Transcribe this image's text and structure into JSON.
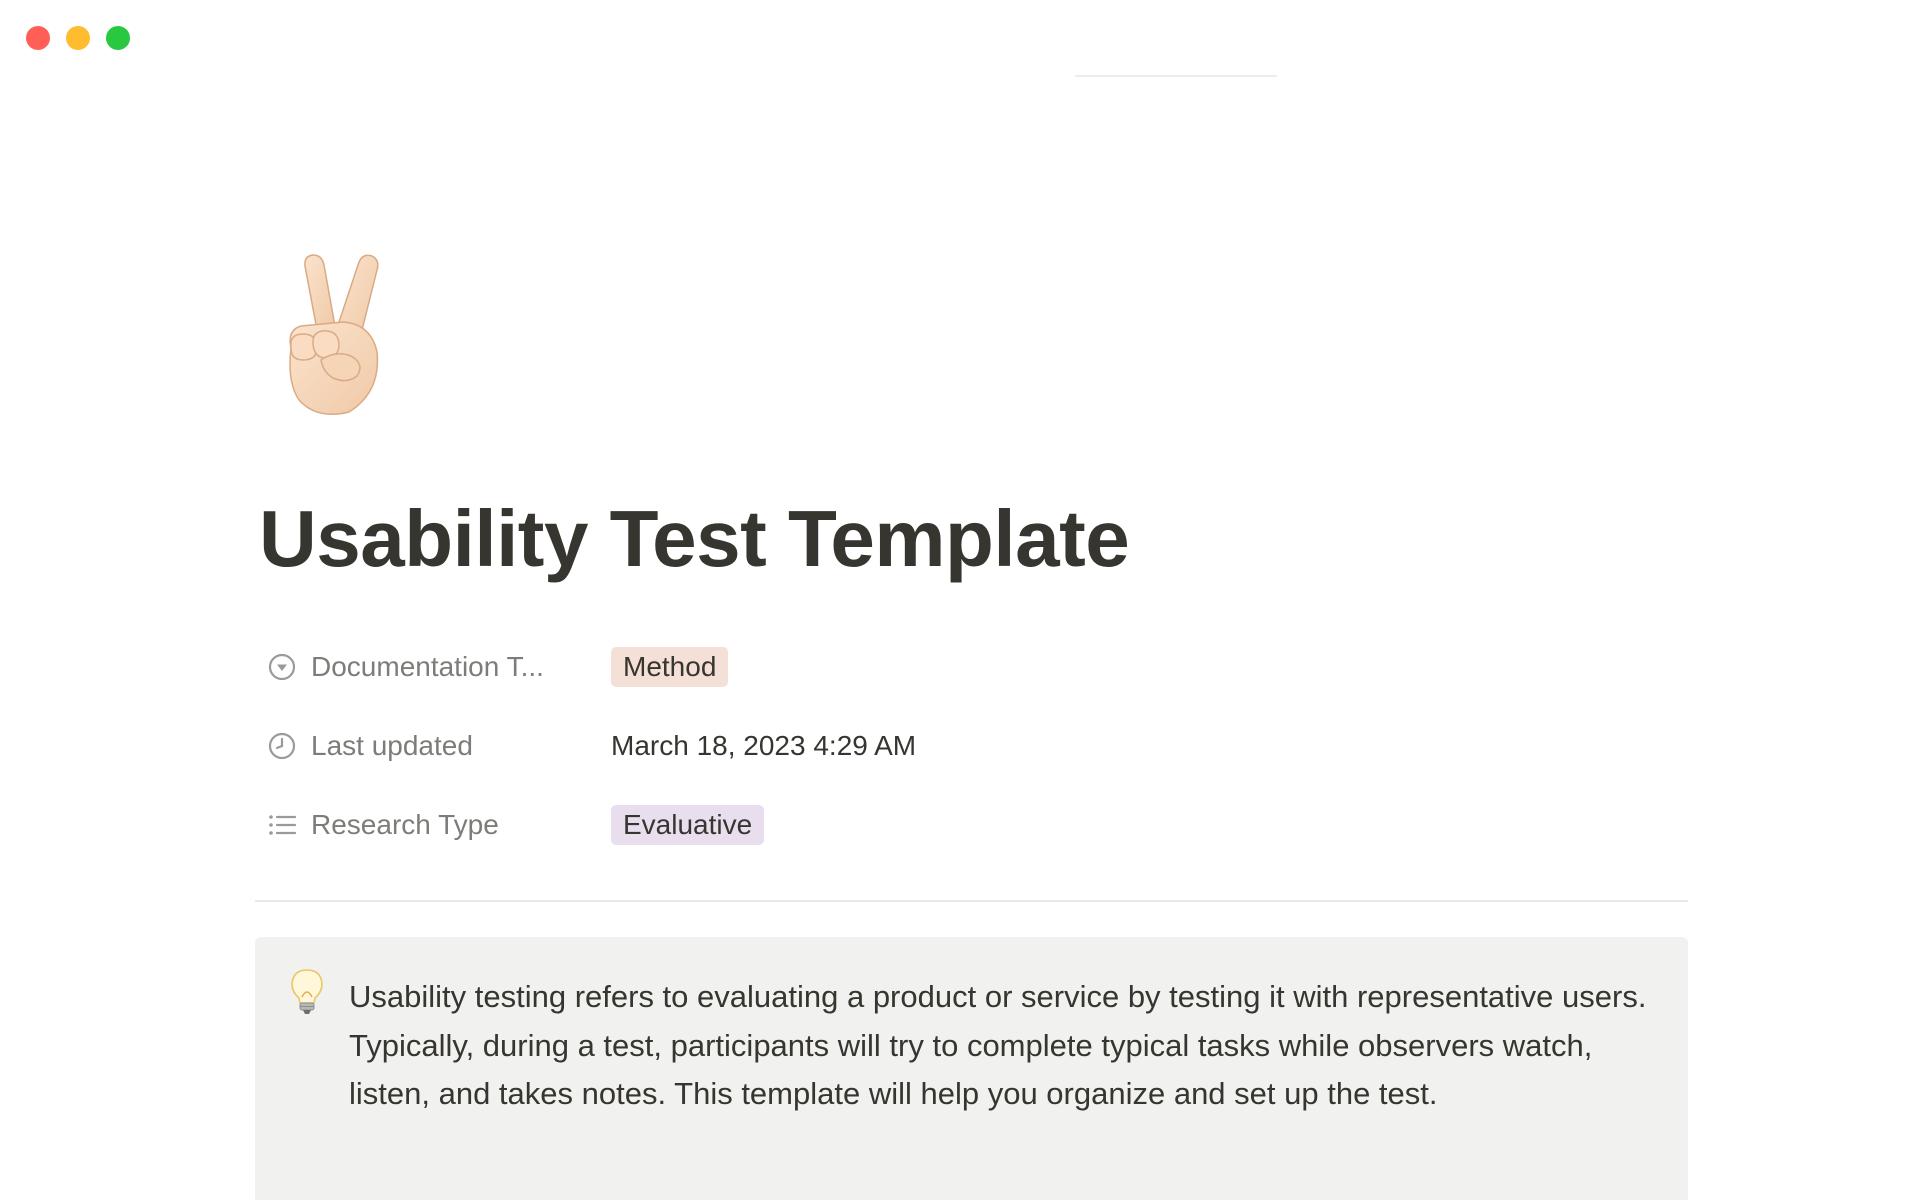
{
  "window": {
    "controls": {
      "close_color": "#ff5f57",
      "minimize_color": "#febc2e",
      "zoom_color": "#28c840"
    }
  },
  "page": {
    "icon": "victory-hand-emoji",
    "title": "Usability Test Template"
  },
  "properties": [
    {
      "icon": "select-circle-icon",
      "label": "Documentation T...",
      "value": "Method",
      "value_kind": "tag",
      "tag_color": "#f5e0d8"
    },
    {
      "icon": "clock-icon",
      "label": "Last updated",
      "value": "March 18, 2023 4:29 AM",
      "value_kind": "text"
    },
    {
      "icon": "list-icon",
      "label": "Research Type",
      "value": "Evaluative",
      "value_kind": "tag",
      "tag_color": "#e8deee"
    }
  ],
  "callout": {
    "icon": "lightbulb-emoji",
    "text": "Usability testing refers to evaluating a product or service by testing it with representative users. Typically, during a test, participants will try to complete typical tasks while observers watch, listen, and takes notes. This template will help you organize and set up the test."
  }
}
